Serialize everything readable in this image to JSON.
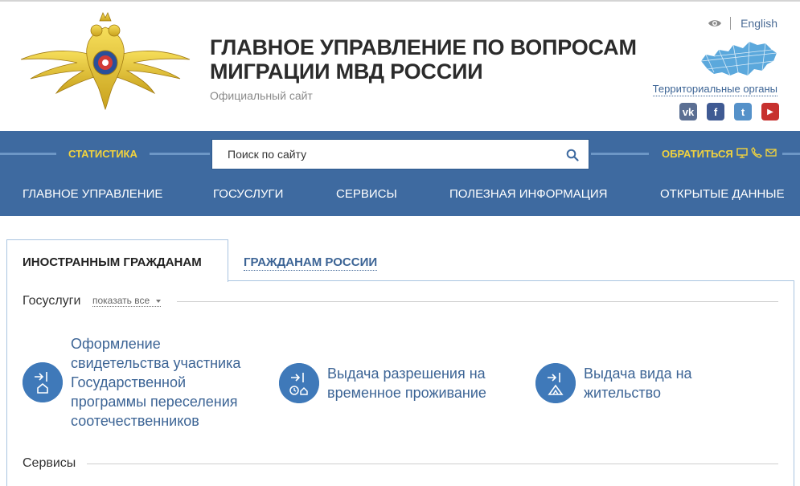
{
  "header": {
    "title_line1": "ГЛАВНОЕ УПРАВЛЕНИЕ ПО ВОПРОСАМ",
    "title_line2": "МИГРАЦИИ МВД РОССИИ",
    "subtitle": "Официальный сайт",
    "language_link": "English",
    "territorial_link": "Территориальные органы",
    "social": [
      {
        "name": "vk",
        "glyph": "vk",
        "color": "#5b6f93"
      },
      {
        "name": "facebook",
        "glyph": "f",
        "color": "#3f5a93"
      },
      {
        "name": "twitter",
        "glyph": "t",
        "color": "#5591c9"
      },
      {
        "name": "youtube",
        "glyph": "▶",
        "color": "#c7312e"
      }
    ]
  },
  "navbar": {
    "statistics_label": "СТАТИСТИКА",
    "search_placeholder": "Поиск по сайту",
    "contact_label": "ОБРАТИТЬСЯ",
    "menu": [
      "ГЛАВНОЕ УПРАВЛЕНИЕ",
      "ГОСУСЛУГИ",
      "СЕРВИСЫ",
      "ПОЛЕЗНАЯ ИНФОРМАЦИЯ",
      "ОТКРЫТЫЕ ДАННЫЕ"
    ]
  },
  "tabs": [
    {
      "label": "ИНОСТРАННЫМ ГРАЖДАНАМ",
      "active": true
    },
    {
      "label": "ГРАЖДАНАМ РОССИИ",
      "active": false
    }
  ],
  "gosuslugi": {
    "title": "Госуслуги",
    "show_all": "показать все",
    "items": [
      {
        "lines": [
          "Оформление",
          "свидетельства участника",
          "Государственной",
          "программы переселения",
          "соотечественников"
        ],
        "icon": "house-icon"
      },
      {
        "lines": [
          "Выдача разрешения на",
          "временное проживание"
        ],
        "icon": "clock-house-icon"
      },
      {
        "lines": [
          "Выдача вида на",
          "жительство"
        ],
        "icon": "tent-icon"
      }
    ]
  },
  "services": {
    "title": "Сервисы"
  },
  "colors": {
    "brand_blue": "#3e6aa0",
    "accent_yellow": "#f2d33d",
    "link_blue": "#3c6495",
    "icon_blue": "#3f79b9"
  }
}
